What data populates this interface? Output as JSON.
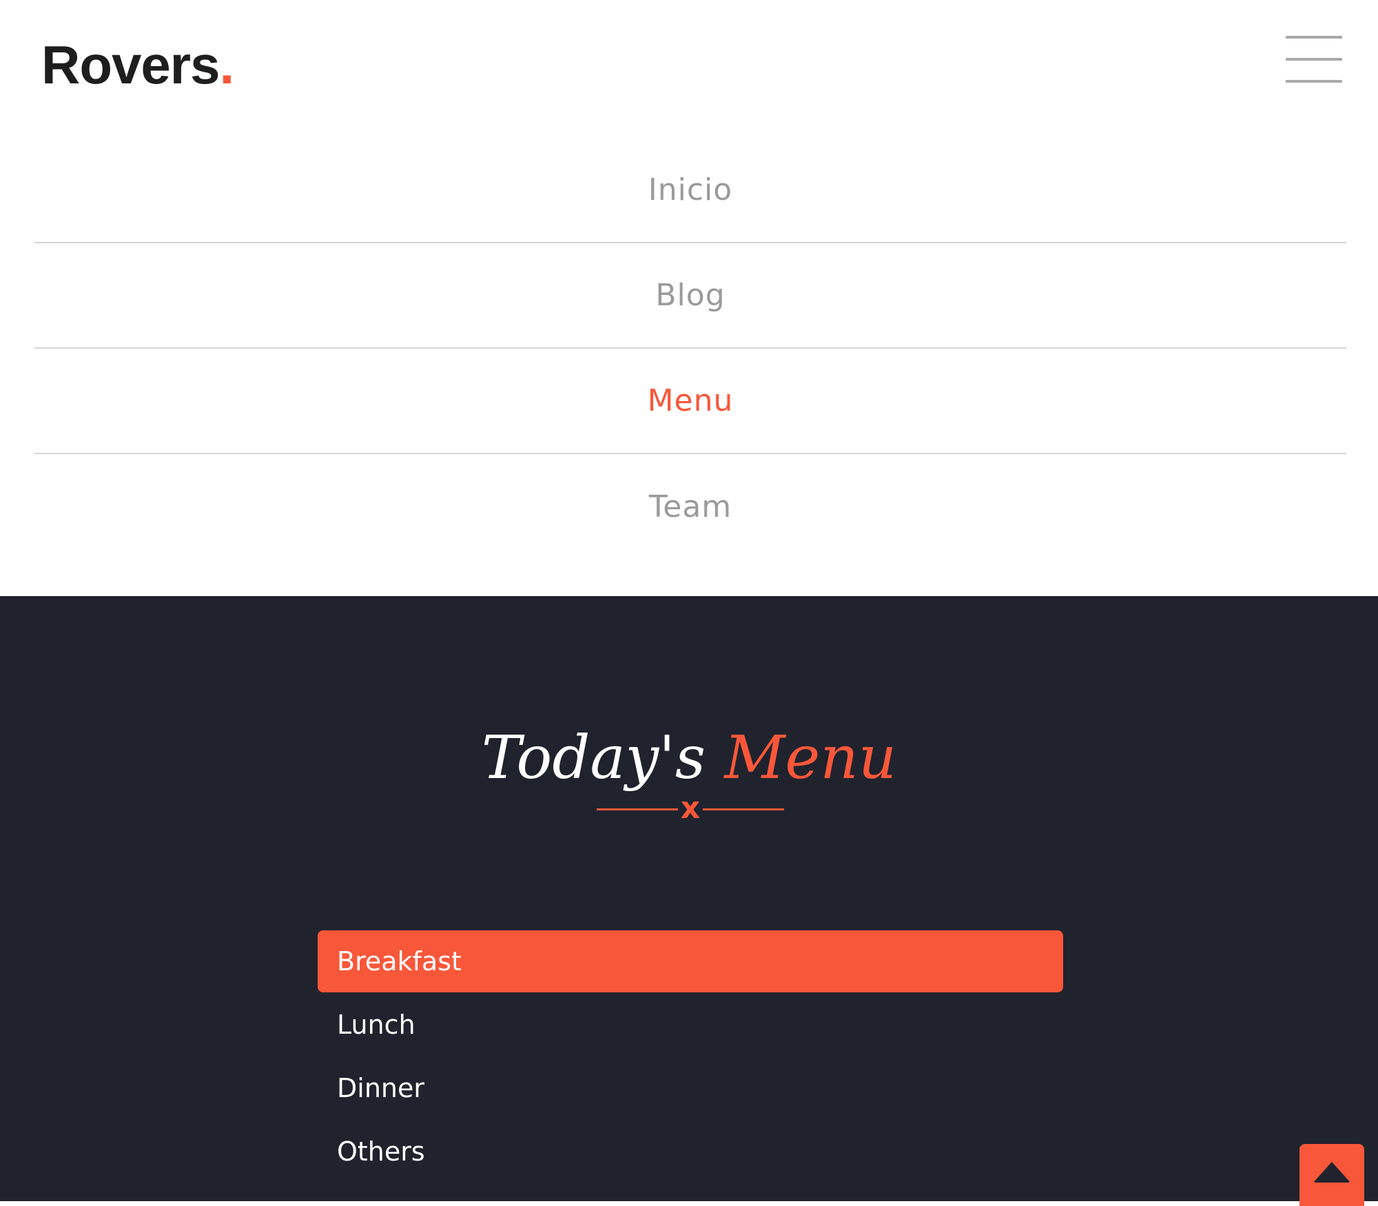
{
  "brand": {
    "name": "Rovers",
    "dot": ".",
    "accent_color": "#f9573a"
  },
  "header": {
    "menu_toggle_icon": "hamburger-icon"
  },
  "nav": {
    "items": [
      {
        "label": "Inicio",
        "active": false
      },
      {
        "label": "Blog",
        "active": false
      },
      {
        "label": "Menu",
        "active": true
      },
      {
        "label": "Team",
        "active": false
      }
    ]
  },
  "section": {
    "title_main": "Today's",
    "title_accent": "Menu",
    "divider_glyph": "x",
    "background_color": "#20232d"
  },
  "menu_tabs": {
    "items": [
      {
        "label": "Breakfast",
        "active": true
      },
      {
        "label": "Lunch",
        "active": false
      },
      {
        "label": "Dinner",
        "active": false
      },
      {
        "label": "Others",
        "active": false
      }
    ]
  },
  "scroll_top": {
    "icon": "caret-up-icon"
  }
}
